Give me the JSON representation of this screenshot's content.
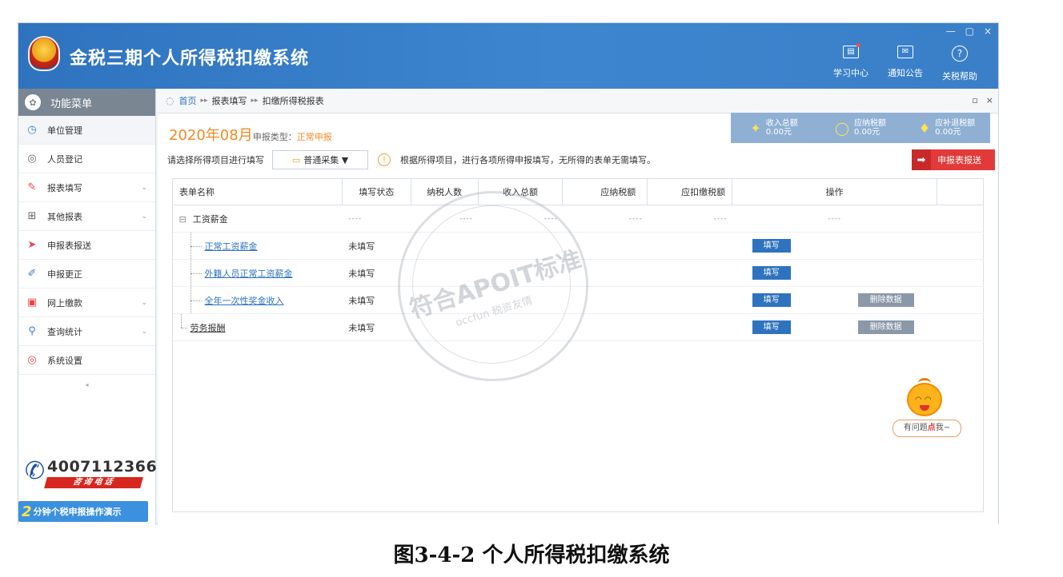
{
  "window_controls": {
    "minimize": "—",
    "restore": "▢",
    "close": "×"
  },
  "header": {
    "title": "金税三期个人所得税扣缴系统",
    "buttons": [
      {
        "label": "学习中心",
        "icon": "study-center-icon"
      },
      {
        "label": "通知公告",
        "icon": "mail-icon"
      },
      {
        "label": "关税帮助",
        "icon": "help-icon"
      }
    ]
  },
  "sidebar": {
    "title": "功能菜单",
    "items": [
      {
        "label": "单位管理",
        "icon": "building-icon",
        "has_arrow": false
      },
      {
        "label": "人员登记",
        "icon": "person-icon",
        "has_arrow": false
      },
      {
        "label": "报表填写",
        "icon": "edit-icon",
        "has_arrow": true
      },
      {
        "label": "其他报表",
        "icon": "grid-icon",
        "has_arrow": true
      },
      {
        "label": "申报表报送",
        "icon": "send-icon",
        "has_arrow": false
      },
      {
        "label": "申报更正",
        "icon": "correct-icon",
        "has_arrow": false
      },
      {
        "label": "网上缴款",
        "icon": "payment-icon",
        "has_arrow": true
      },
      {
        "label": "查询统计",
        "icon": "search-icon",
        "has_arrow": true
      },
      {
        "label": "系统设置",
        "icon": "settings-icon",
        "has_arrow": false
      }
    ],
    "phone": "4007112366",
    "phone_tag": "咨询电话",
    "banner_num": "2",
    "banner_text": "分钟个税申报操作演示"
  },
  "breadcrumb": {
    "home": "首页",
    "level2": "报表填写",
    "level3": "扣缴所得税报表",
    "sep": "▸▸",
    "ctl_restore": "▫",
    "ctl_close": "×"
  },
  "period": {
    "month": "2020年08月",
    "type_label": "申报类型：",
    "status": "正常申报"
  },
  "stats": [
    {
      "label": "收入总额",
      "value": "0.00元"
    },
    {
      "label": "应纳税额",
      "value": "0.00元"
    },
    {
      "label": "应补退税额",
      "value": "0.00元"
    }
  ],
  "toolbar": {
    "label": "请选择所得项目进行填写",
    "select_value": "普通采集 ▼",
    "tip": "根据所得项目，进行各项所得申报填写，无所得的表单无需填写。",
    "declare_button": "申报表报送"
  },
  "table": {
    "headers": [
      "表单名称",
      "填写状态",
      "纳税人数",
      "收入总额",
      "应纳税额",
      "应扣缴税额",
      "操作"
    ],
    "rows": [
      {
        "name": "工资薪金",
        "status": "----",
        "kind": "root",
        "toggle": "⊟",
        "ops": []
      },
      {
        "name": "正常工资薪金",
        "status": "未填写",
        "kind": "leaf",
        "ops": [
          "填写"
        ]
      },
      {
        "name": "外籍人员正常工资薪金",
        "status": "未填写",
        "kind": "leaf",
        "ops": [
          "填写"
        ]
      },
      {
        "name": "全年一次性奖金收入",
        "status": "未填写",
        "kind": "leaf",
        "ops": [
          "填写",
          "删除数据"
        ]
      },
      {
        "name": "劳务报酬",
        "status": "未填写",
        "kind": "sub",
        "ops": [
          "填写",
          "删除数据"
        ]
      }
    ],
    "dash": "----"
  },
  "watermark": {
    "main": "符合APOIT标准",
    "sub": "occfun 税资友情"
  },
  "mascot": {
    "before": "有问题",
    "highlight": "点",
    "after": "我~"
  },
  "caption": "图3-4-2  个人所得税扣缴系统"
}
